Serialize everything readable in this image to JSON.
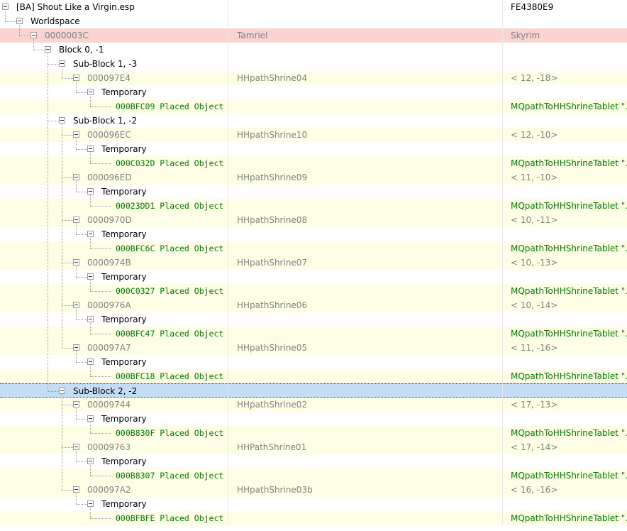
{
  "tree": {
    "rows": [
      {
        "col1": "[BA] Shout Like a Virgin.esp",
        "col2": "",
        "col3": "FE4380E9",
        "depth": 0,
        "toggle": true,
        "kind": "plugin",
        "bg": "white"
      },
      {
        "col1": "Worldspace",
        "col2": "",
        "col3": "",
        "depth": 1,
        "toggle": true,
        "kind": "group",
        "bg": "white"
      },
      {
        "col1": "0000003C",
        "col2": "Tamriel",
        "col3": "Skyrim",
        "depth": 2,
        "toggle": true,
        "kind": "record",
        "bg": "red"
      },
      {
        "col1": "Block 0, -1",
        "col2": "",
        "col3": "",
        "depth": 3,
        "toggle": true,
        "kind": "group",
        "bg": "white"
      },
      {
        "col1": "Sub-Block 1, -3",
        "col2": "",
        "col3": "",
        "depth": 4,
        "toggle": true,
        "kind": "group",
        "bg": "white"
      },
      {
        "col1": "000097E4",
        "col2": "HHpathShrine04",
        "col3": "< 12, -18>",
        "depth": 5,
        "toggle": true,
        "kind": "record",
        "bg": "alt"
      },
      {
        "col1": "Temporary",
        "col2": "",
        "col3": "",
        "depth": 6,
        "toggle": true,
        "kind": "group",
        "bg": "white"
      },
      {
        "col1": "000BFC09  Placed Object",
        "col2": "",
        "col3": "MQpathToHHShrineTablet \"...",
        "depth": 7,
        "toggle": false,
        "kind": "placed",
        "bg": "alt"
      },
      {
        "col1": "Sub-Block 1, -2",
        "col2": "",
        "col3": "",
        "depth": 4,
        "toggle": true,
        "kind": "group",
        "bg": "white"
      },
      {
        "col1": "000096EC",
        "col2": "HHpathShrine10",
        "col3": "< 12, -10>",
        "depth": 5,
        "toggle": true,
        "kind": "record",
        "bg": "alt"
      },
      {
        "col1": "Temporary",
        "col2": "",
        "col3": "",
        "depth": 6,
        "toggle": true,
        "kind": "group",
        "bg": "white"
      },
      {
        "col1": "000C032D  Placed Object",
        "col2": "",
        "col3": "MQpathToHHShrineTablet \"...",
        "depth": 7,
        "toggle": false,
        "kind": "placed",
        "bg": "alt"
      },
      {
        "col1": "000096ED",
        "col2": "HHpathShrine09",
        "col3": "< 11, -10>",
        "depth": 5,
        "toggle": true,
        "kind": "record",
        "bg": "alt"
      },
      {
        "col1": "Temporary",
        "col2": "",
        "col3": "",
        "depth": 6,
        "toggle": true,
        "kind": "group",
        "bg": "white"
      },
      {
        "col1": "00023DD1  Placed Object",
        "col2": "",
        "col3": "MQpathToHHShrineTablet \"...",
        "depth": 7,
        "toggle": false,
        "kind": "placed",
        "bg": "alt"
      },
      {
        "col1": "0000970D",
        "col2": "HHpathShrine08",
        "col3": "< 10, -11>",
        "depth": 5,
        "toggle": true,
        "kind": "record",
        "bg": "alt"
      },
      {
        "col1": "Temporary",
        "col2": "",
        "col3": "",
        "depth": 6,
        "toggle": true,
        "kind": "group",
        "bg": "white"
      },
      {
        "col1": "000BFC6C  Placed Object",
        "col2": "",
        "col3": "MQpathToHHShrineTablet \"...",
        "depth": 7,
        "toggle": false,
        "kind": "placed",
        "bg": "alt"
      },
      {
        "col1": "0000974B",
        "col2": "HHpathShrine07",
        "col3": "< 10, -13>",
        "depth": 5,
        "toggle": true,
        "kind": "record",
        "bg": "alt"
      },
      {
        "col1": "Temporary",
        "col2": "",
        "col3": "",
        "depth": 6,
        "toggle": true,
        "kind": "group",
        "bg": "white"
      },
      {
        "col1": "000C0327  Placed Object",
        "col2": "",
        "col3": "MQpathToHHShrineTablet \"...",
        "depth": 7,
        "toggle": false,
        "kind": "placed",
        "bg": "alt"
      },
      {
        "col1": "0000976A",
        "col2": "HHpathShrine06",
        "col3": "< 10, -14>",
        "depth": 5,
        "toggle": true,
        "kind": "record",
        "bg": "alt"
      },
      {
        "col1": "Temporary",
        "col2": "",
        "col3": "",
        "depth": 6,
        "toggle": true,
        "kind": "group",
        "bg": "white"
      },
      {
        "col1": "000BFC47  Placed Object",
        "col2": "",
        "col3": "MQpathToHHShrineTablet \"...",
        "depth": 7,
        "toggle": false,
        "kind": "placed",
        "bg": "alt"
      },
      {
        "col1": "000097A7",
        "col2": "HHpathShrine05",
        "col3": "< 11, -16>",
        "depth": 5,
        "toggle": true,
        "kind": "record",
        "bg": "alt"
      },
      {
        "col1": "Temporary",
        "col2": "",
        "col3": "",
        "depth": 6,
        "toggle": true,
        "kind": "group",
        "bg": "white"
      },
      {
        "col1": "000BFC18  Placed Object",
        "col2": "",
        "col3": "MQpathToHHShrineTablet \"...",
        "depth": 7,
        "toggle": false,
        "kind": "placed",
        "bg": "alt"
      },
      {
        "col1": "Sub-Block 2, -2",
        "col2": "",
        "col3": "",
        "depth": 4,
        "toggle": true,
        "kind": "group",
        "bg": "selected"
      },
      {
        "col1": "00009744",
        "col2": "HHpathShrine02",
        "col3": "< 17, -13>",
        "depth": 5,
        "toggle": true,
        "kind": "record",
        "bg": "alt"
      },
      {
        "col1": "Temporary",
        "col2": "",
        "col3": "",
        "depth": 6,
        "toggle": true,
        "kind": "group",
        "bg": "white"
      },
      {
        "col1": "000B830F  Placed Object",
        "col2": "",
        "col3": "MQpathToHHShrineTablet \"...",
        "depth": 7,
        "toggle": false,
        "kind": "placed",
        "bg": "alt"
      },
      {
        "col1": "00009763",
        "col2": "HHPathShrine01",
        "col3": "< 17, -14>",
        "depth": 5,
        "toggle": true,
        "kind": "record",
        "bg": "alt"
      },
      {
        "col1": "Temporary",
        "col2": "",
        "col3": "",
        "depth": 6,
        "toggle": true,
        "kind": "group",
        "bg": "white"
      },
      {
        "col1": "000B8307  Placed Object",
        "col2": "",
        "col3": "MQpathToHHShrineTablet \"...",
        "depth": 7,
        "toggle": false,
        "kind": "placed",
        "bg": "alt"
      },
      {
        "col1": "000097A2",
        "col2": "HHpathShrine03b",
        "col3": "< 16, -16>",
        "depth": 5,
        "toggle": true,
        "kind": "record",
        "bg": "alt"
      },
      {
        "col1": "Temporary",
        "col2": "",
        "col3": "",
        "depth": 6,
        "toggle": true,
        "kind": "group",
        "bg": "white"
      },
      {
        "col1": "000BFBFE  Placed Object",
        "col2": "",
        "col3": "MQpathToHHShrineTablet \"...",
        "depth": 7,
        "toggle": false,
        "kind": "placed",
        "bg": "alt"
      }
    ]
  },
  "colors": {
    "row_alt": "#fefee6",
    "row_red": "#fad3d3",
    "row_selected": "#c4dcf4",
    "text_gray": "#808080",
    "text_green": "#008000"
  }
}
